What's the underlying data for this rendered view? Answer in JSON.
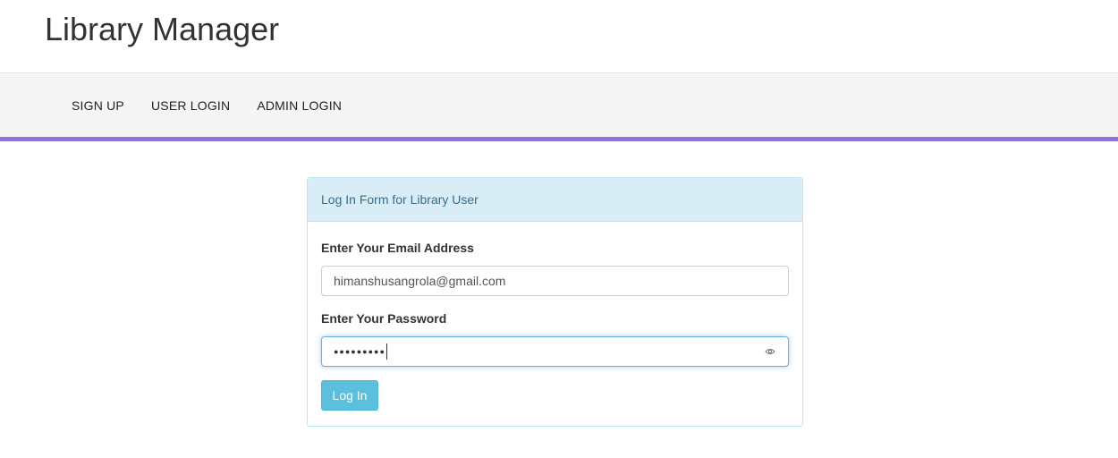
{
  "app": {
    "title": "Library Manager"
  },
  "nav": {
    "items": [
      {
        "label": "SIGN UP"
      },
      {
        "label": "USER LOGIN"
      },
      {
        "label": "ADMIN LOGIN"
      }
    ]
  },
  "form": {
    "heading": "Log In Form for Library User",
    "email_label": "Enter Your Email Address",
    "email_value": "himanshusangrola@gmail.com",
    "password_label": "Enter Your Password",
    "password_masked": "●●●●●●●●●",
    "password_reveal_icon": "eye-icon",
    "submit_label": "Log In"
  },
  "colors": {
    "nav_accent": "#9370db",
    "panel_heading_bg": "#d9edf7",
    "panel_heading_text": "#31708f",
    "button_bg": "#5bc0de"
  }
}
